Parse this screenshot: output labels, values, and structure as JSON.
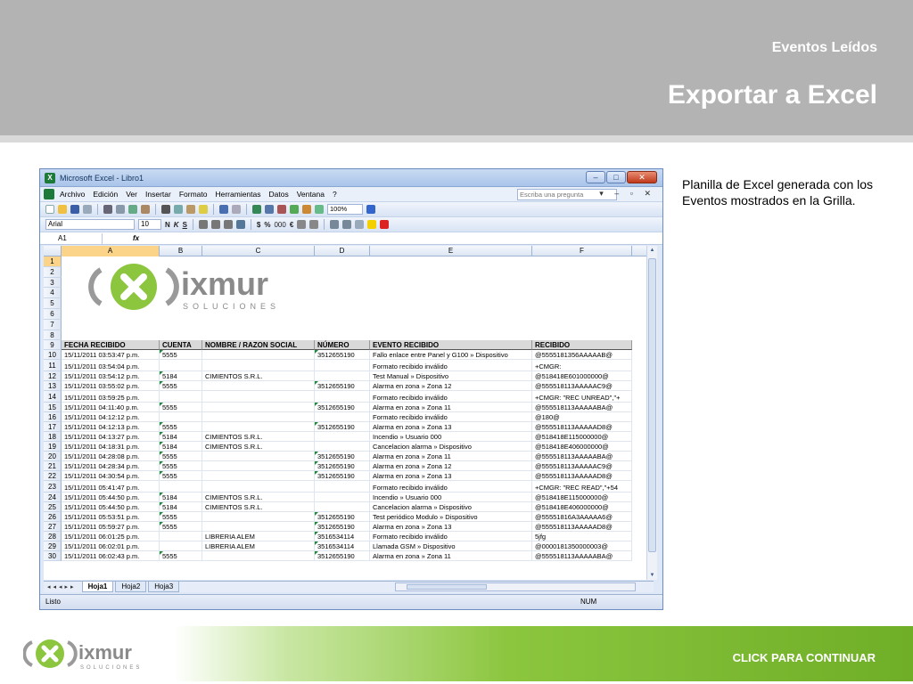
{
  "header": {
    "subtitle": "Eventos Leídos",
    "title": "Exportar a Excel"
  },
  "description": "Planilla de Excel generada con los Eventos mostrados en la Grilla.",
  "excel": {
    "window_title": "Microsoft Excel - Libro1",
    "window_buttons": [
      "–",
      "□",
      "✕"
    ],
    "menu": [
      "Archivo",
      "Edición",
      "Ver",
      "Insertar",
      "Formato",
      "Herramientas",
      "Datos",
      "Ventana",
      "?"
    ],
    "ask_placeholder": "Escriba una pregunta",
    "zoom": "100%",
    "font_name": "Arial",
    "font_size": "10",
    "format_buttons": [
      "N",
      "K",
      "S",
      "$",
      "%",
      "000",
      "€"
    ],
    "name_box": "A1",
    "fx": "fx",
    "columns": [
      "A",
      "B",
      "C",
      "D",
      "E",
      "F"
    ],
    "logo_text": "ixmur",
    "logo_sub": "SOLUCIONES",
    "table_headers": [
      "FECHA RECIBIDO",
      "CUENTA",
      "NOMBRE / RAZON SOCIAL",
      "NÚMERO",
      "EVENTO RECIBIDO",
      "RECIBIDO"
    ],
    "rows": [
      {
        "n": "10",
        "a": "15/11/2011 03:53:47 p.m.",
        "b": "5555",
        "c": "",
        "d": "3512655190",
        "e": "Fallo enlace entre Panel y G100 » Dispositivo",
        "f": "@5555181356AAAAAB@"
      },
      {
        "n": "11",
        "a": "15/11/2011 03:54:04 p.m.",
        "b": "",
        "c": "",
        "d": "",
        "e": "Formato recibido inválido",
        "f": "+CMGR:"
      },
      {
        "n": "12",
        "a": "15/11/2011 03:54:12 p.m.",
        "b": "5184",
        "c": "CIMIENTOS S.R.L.",
        "d": "",
        "e": "Test Manual » Dispositivo",
        "f": "@518418E601000000@"
      },
      {
        "n": "13",
        "a": "15/11/2011 03:55:02 p.m.",
        "b": "5555",
        "c": "",
        "d": "3512655190",
        "e": "Alarma en zona » Zona 12",
        "f": "@555518113AAAAAC9@"
      },
      {
        "n": "14",
        "a": "15/11/2011 03:59:25 p.m.",
        "b": "",
        "c": "",
        "d": "",
        "e": "Formato recibido inválido",
        "f": "+CMGR: \"REC UNREAD\",\"+"
      },
      {
        "n": "15",
        "a": "15/11/2011 04:11:40 p.m.",
        "b": "5555",
        "c": "",
        "d": "3512655190",
        "e": "Alarma en zona » Zona 11",
        "f": "@555518113AAAAABA@"
      },
      {
        "n": "16",
        "a": "15/11/2011 04:12:12 p.m.",
        "b": "",
        "c": "",
        "d": "",
        "e": "Formato recibido inválido",
        "f": "@180@"
      },
      {
        "n": "17",
        "a": "15/11/2011 04:12:13 p.m.",
        "b": "5555",
        "c": "",
        "d": "3512655190",
        "e": "Alarma en zona » Zona 13",
        "f": "@555518113AAAAAD8@"
      },
      {
        "n": "18",
        "a": "15/11/2011 04:13:27 p.m.",
        "b": "5184",
        "c": "CIMIENTOS S.R.L.",
        "d": "",
        "e": "Incendio » Usuario 000",
        "f": "@518418E115000000@"
      },
      {
        "n": "19",
        "a": "15/11/2011 04:18:31 p.m.",
        "b": "5184",
        "c": "CIMIENTOS S.R.L.",
        "d": "",
        "e": "Cancelacion alarma » Dispositivo",
        "f": "@518418E406000000@"
      },
      {
        "n": "20",
        "a": "15/11/2011 04:28:08 p.m.",
        "b": "5555",
        "c": "",
        "d": "3512655190",
        "e": "Alarma en zona » Zona 11",
        "f": "@555518113AAAAABA@"
      },
      {
        "n": "21",
        "a": "15/11/2011 04:28:34 p.m.",
        "b": "5555",
        "c": "",
        "d": "3512655190",
        "e": "Alarma en zona » Zona 12",
        "f": "@555518113AAAAAC9@"
      },
      {
        "n": "22",
        "a": "15/11/2011 04:30:54 p.m.",
        "b": "5555",
        "c": "",
        "d": "3512655190",
        "e": "Alarma en zona » Zona 13",
        "f": "@555518113AAAAAD8@"
      },
      {
        "n": "23",
        "a": "15/11/2011 05:41:47 p.m.",
        "b": "",
        "c": "",
        "d": "",
        "e": "Formato recibido inválido",
        "f": "+CMGR: \"REC READ\",\"+54"
      },
      {
        "n": "24",
        "a": "15/11/2011 05:44:50 p.m.",
        "b": "5184",
        "c": "CIMIENTOS S.R.L.",
        "d": "",
        "e": "Incendio » Usuario 000",
        "f": "@518418E115000000@"
      },
      {
        "n": "25",
        "a": "15/11/2011 05:44:50 p.m.",
        "b": "5184",
        "c": "CIMIENTOS S.R.L.",
        "d": "",
        "e": "Cancelacion alarma » Dispositivo",
        "f": "@518418E406000000@"
      },
      {
        "n": "26",
        "a": "15/11/2011 05:53:51 p.m.",
        "b": "5555",
        "c": "",
        "d": "3512655190",
        "e": "Test periódico Modulo » Dispositivo",
        "f": "@55551816A3AAAAA6@"
      },
      {
        "n": "27",
        "a": "15/11/2011 05:59:27 p.m.",
        "b": "5555",
        "c": "",
        "d": "3512655190",
        "e": "Alarma en zona » Zona 13",
        "f": "@555518113AAAAAD8@"
      },
      {
        "n": "28",
        "a": "15/11/2011 06:01:25 p.m.",
        "b": "",
        "c": "LIBRERIA ALEM",
        "d": "3516534114",
        "e": "Formato recibido inválido",
        "f": "5jfg"
      },
      {
        "n": "29",
        "a": "15/11/2011 06:02:01 p.m.",
        "b": "",
        "c": "LIBRERIA ALEM",
        "d": "3516534114",
        "e": "Llamada GSM » Dispositivo",
        "f": "@0000181350000003@"
      },
      {
        "n": "30",
        "a": "15/11/2011 06:02:43 p.m.",
        "b": "5555",
        "c": "",
        "d": "3512655190",
        "e": "Alarma en zona » Zona 11",
        "f": "@555518113AAAAABA@"
      }
    ],
    "sheets": [
      "Hoja1",
      "Hoja2",
      "Hoja3"
    ],
    "status": "Listo",
    "num": "NUM"
  },
  "footer": {
    "cta": "CLICK PARA CONTINUAR",
    "logo_text": "ixmur",
    "logo_sub": "SOLUCIONES"
  },
  "colors": {
    "header_gray": "#b3b3b3",
    "brand_green": "#8cc63f",
    "logo_gray": "#777777"
  }
}
